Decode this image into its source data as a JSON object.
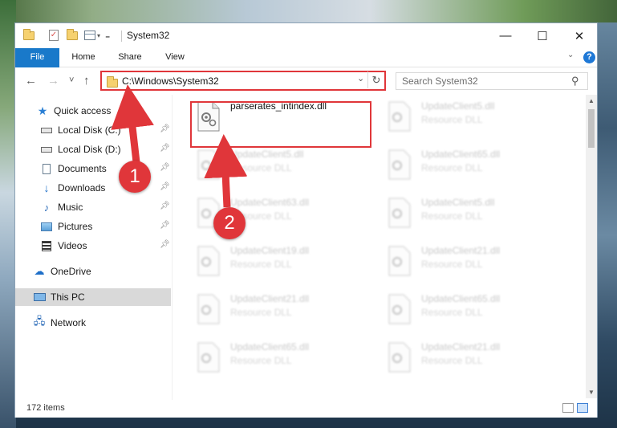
{
  "window": {
    "title": "System32",
    "minimize_glyph": "—",
    "maximize_glyph": "☐",
    "close_glyph": "✕"
  },
  "ribbon": {
    "tabs": [
      "File",
      "Home",
      "Share",
      "View"
    ]
  },
  "navigation": {
    "back_glyph": "←",
    "forward_glyph": "→",
    "recent_glyph": "˅",
    "up_glyph": "↑",
    "address": "C:\\Windows\\System32",
    "refresh_glyph": "↻",
    "search_placeholder": "Search System32"
  },
  "sidebar": {
    "items": [
      {
        "label": "Quick access",
        "icon": "star-icon"
      },
      {
        "label": "Local Disk (C:)",
        "icon": "drive-icon",
        "pinned": true
      },
      {
        "label": "Local Disk (D:)",
        "icon": "drive-icon",
        "pinned": true
      },
      {
        "label": "Documents",
        "icon": "documents-icon",
        "pinned": true
      },
      {
        "label": "Downloads",
        "icon": "downloads-icon",
        "pinned": true
      },
      {
        "label": "Music",
        "icon": "music-icon",
        "pinned": true
      },
      {
        "label": "Pictures",
        "icon": "pictures-icon",
        "pinned": true
      },
      {
        "label": "Videos",
        "icon": "videos-icon",
        "pinned": true
      },
      {
        "label": "OneDrive",
        "icon": "cloud-icon"
      },
      {
        "label": "This PC",
        "icon": "computer-icon",
        "selected": true
      },
      {
        "label": "Network",
        "icon": "network-icon"
      }
    ]
  },
  "files": [
    {
      "name": "parserates_intindex.dll",
      "type": "",
      "highlighted": true
    },
    {
      "name": "UpdateClient5.dll",
      "type": "Resource DLL"
    },
    {
      "name": "UpdateClient5.dll",
      "type": "Resource DLL"
    },
    {
      "name": "UpdateClient65.dll",
      "type": "Resource DLL"
    },
    {
      "name": "UpdateClient63.dll",
      "type": "Resource DLL"
    },
    {
      "name": "UpdateClient5.dll",
      "type": "Resource DLL"
    },
    {
      "name": "UpdateClient19.dll",
      "type": "Resource DLL"
    },
    {
      "name": "UpdateClient21.dll",
      "type": "Resource DLL"
    },
    {
      "name": "UpdateClient21.dll",
      "type": "Resource DLL"
    },
    {
      "name": "UpdateClient65.dll",
      "type": "Resource DLL"
    },
    {
      "name": "UpdateClient65.dll",
      "type": "Resource DLL"
    },
    {
      "name": "UpdateClient21.dll",
      "type": "Resource DLL"
    }
  ],
  "status": {
    "item_count": "172 items"
  },
  "annotations": {
    "step1": "1",
    "step2": "2"
  },
  "colors": {
    "accent_blue": "#1979ca",
    "annotation_red": "#e0363a",
    "selected_bg": "#d9d9d9"
  }
}
